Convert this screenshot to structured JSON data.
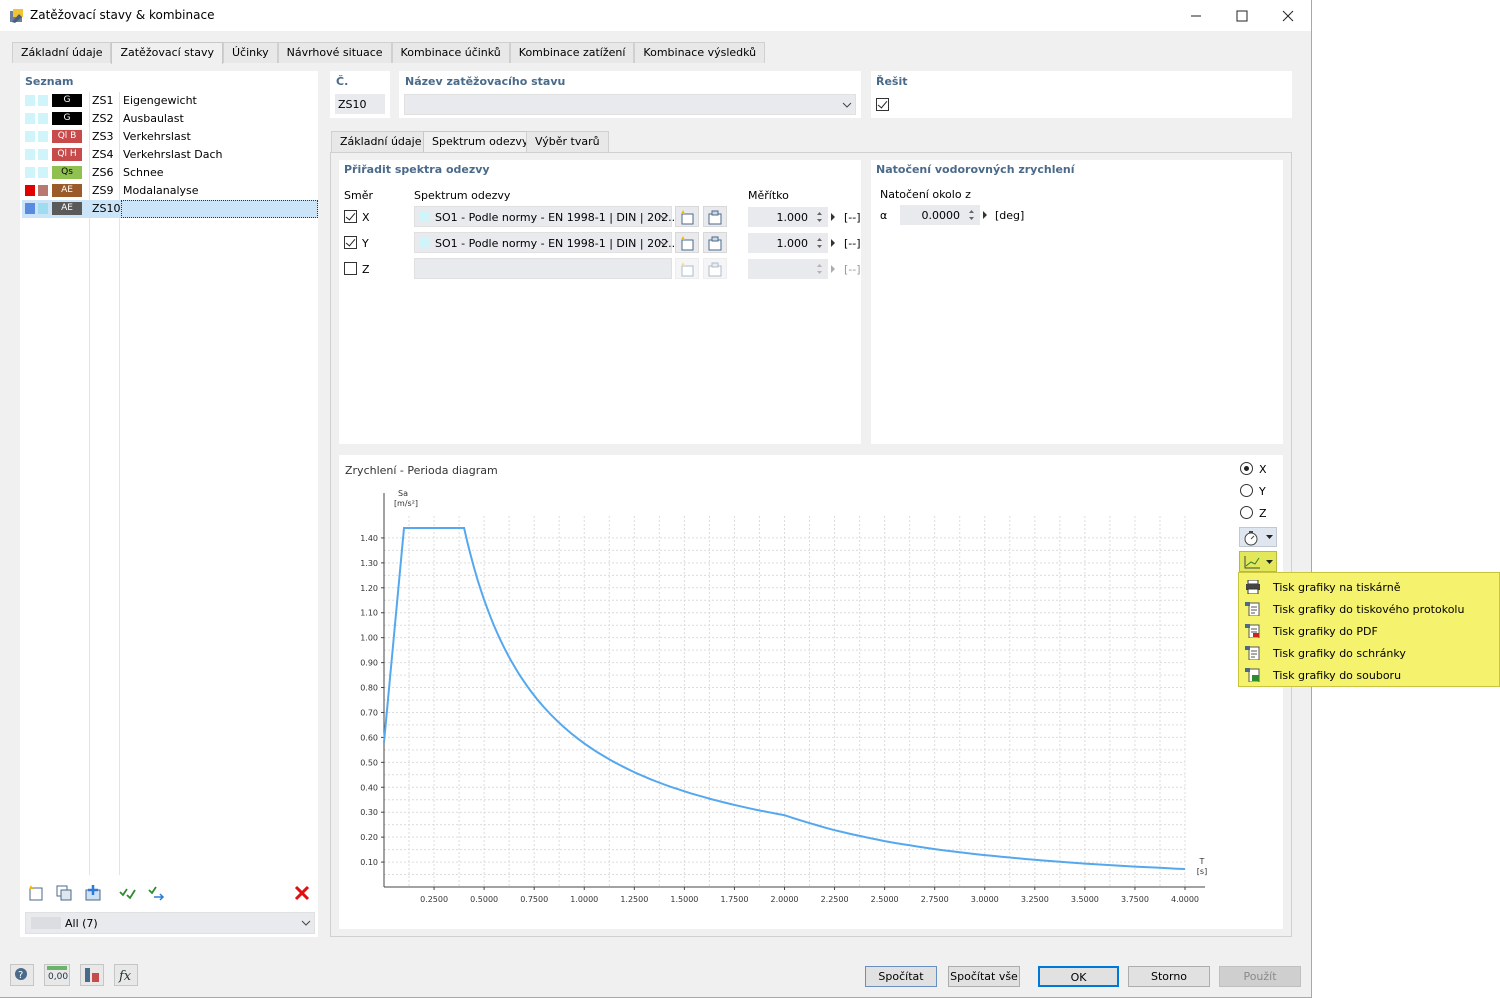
{
  "window": {
    "title": "Zatěžovací stavy & kombinace"
  },
  "tabs": [
    "Základní údaje",
    "Zatěžovací stavy",
    "Účinky",
    "Návrhové situace",
    "Kombinace účinků",
    "Kombinace zatížení",
    "Kombinace výsledků"
  ],
  "list": {
    "header": "Seznam",
    "items": [
      {
        "c1": "#cff5fa",
        "c2": "#cff5fa",
        "badge": "G",
        "badge_color": "#000000",
        "id": "ZS1",
        "name": "Eigengewicht"
      },
      {
        "c1": "#cff5fa",
        "c2": "#cff5fa",
        "badge": "G",
        "badge_color": "#000000",
        "id": "ZS2",
        "name": "Ausbaulast"
      },
      {
        "c1": "#cff5fa",
        "c2": "#cff5fa",
        "badge": "Ql B",
        "badge_color": "#c84b4b",
        "id": "ZS3",
        "name": "Verkehrslast"
      },
      {
        "c1": "#cff5fa",
        "c2": "#cff5fa",
        "badge": "Ql H",
        "badge_color": "#c84b4b",
        "id": "ZS4",
        "name": "Verkehrslast Dach"
      },
      {
        "c1": "#cff5fa",
        "c2": "#cff5fa",
        "badge": "Qs",
        "badge_color": "#8fc050",
        "id": "ZS6",
        "name": "Schnee"
      },
      {
        "c1": "#e00000",
        "c2": "#b87a70",
        "badge": "AE",
        "badge_color": "#9a5a2a",
        "id": "ZS9",
        "name": "Modalanalyse"
      },
      {
        "c1": "#5b8be0",
        "c2": "#a0dcef",
        "badge": "AE",
        "badge_color": "#5a5a5a",
        "id": "ZS10",
        "name": ""
      }
    ],
    "filter": "All (7)"
  },
  "top": {
    "no_label": "Č.",
    "no_value": "ZS10",
    "name_label": "Název zatěžovacího stavu",
    "name_value": "",
    "solve_label": "Řešit"
  },
  "subtabs": [
    "Základní údaje",
    "Spektrum odezvy",
    "Výběr tvarů"
  ],
  "assign": {
    "header": "Přiřadit spektra odezvy",
    "col_dir": "Směr",
    "col_spec": "Spektrum odezvy",
    "col_scale": "Měřítko",
    "rows": [
      {
        "dir": "X",
        "checked": true,
        "spectrum": "SO1 - Podle normy - EN 1998-1 | DIN | 202...",
        "scale": "1.000",
        "unit": "[--]"
      },
      {
        "dir": "Y",
        "checked": true,
        "spectrum": "SO1 - Podle normy - EN 1998-1 | DIN | 202...",
        "scale": "1.000",
        "unit": "[--]"
      },
      {
        "dir": "Z",
        "checked": false,
        "spectrum": "",
        "scale": "",
        "unit": "[--]"
      }
    ]
  },
  "rotation": {
    "header": "Natočení vodorovných zrychlení",
    "label": "Natočení okolo z",
    "symbol": "α",
    "value": "0.0000",
    "unit": "[deg]"
  },
  "diagram": {
    "title": "Zrychlení - Perioda diagram",
    "radios": [
      "X",
      "Y",
      "Z"
    ],
    "selected_radio": "X"
  },
  "chart_data": {
    "type": "line",
    "ylabel_top": "Sa",
    "ylabel_unit": "[m/s²]",
    "xlabel": "T",
    "xlabel_unit": "[s]",
    "xlim": [
      0,
      4
    ],
    "ylim": [
      0,
      1.5
    ],
    "grid": true,
    "xticks": [
      "0.2500",
      "0.5000",
      "0.7500",
      "1.0000",
      "1.2500",
      "1.5000",
      "1.7500",
      "2.0000",
      "2.2500",
      "2.5000",
      "2.7500",
      "3.0000",
      "3.2500",
      "3.5000",
      "3.7500",
      "4.0000"
    ],
    "yticks": [
      "0.10",
      "0.20",
      "0.30",
      "0.40",
      "0.50",
      "0.60",
      "0.70",
      "0.80",
      "0.90",
      "1.00",
      "1.10",
      "1.20",
      "1.30",
      "1.40"
    ],
    "series": [
      {
        "color": "#55a8ee",
        "x": [
          0,
          0.1,
          0.4,
          0.5,
          0.6,
          0.7,
          0.8,
          1.0,
          1.2,
          1.4,
          1.6,
          1.8,
          2.0,
          2.25,
          2.5,
          2.75,
          3.0,
          3.25,
          3.5,
          3.75,
          4.0
        ],
        "y": [
          0.58,
          1.44,
          1.44,
          1.152,
          0.96,
          0.823,
          0.72,
          0.576,
          0.48,
          0.411,
          0.36,
          0.32,
          0.288,
          0.228,
          0.184,
          0.152,
          0.128,
          0.109,
          0.094,
          0.082,
          0.072
        ]
      }
    ]
  },
  "menu": {
    "items": [
      "Tisk grafiky na tiskárně",
      "Tisk grafiky do tiskového protokolu",
      "Tisk grafiky do PDF",
      "Tisk grafiky do schránky",
      "Tisk grafiky do souboru"
    ]
  },
  "buttons": {
    "calc": "Spočítat",
    "calc_all": "Spočítat vše",
    "ok": "OK",
    "cancel": "Storno",
    "apply": "Použít"
  },
  "status_icons": [
    "help-icon",
    "units-icon",
    "model-icon",
    "function-icon"
  ],
  "status_units_text": "0,00"
}
